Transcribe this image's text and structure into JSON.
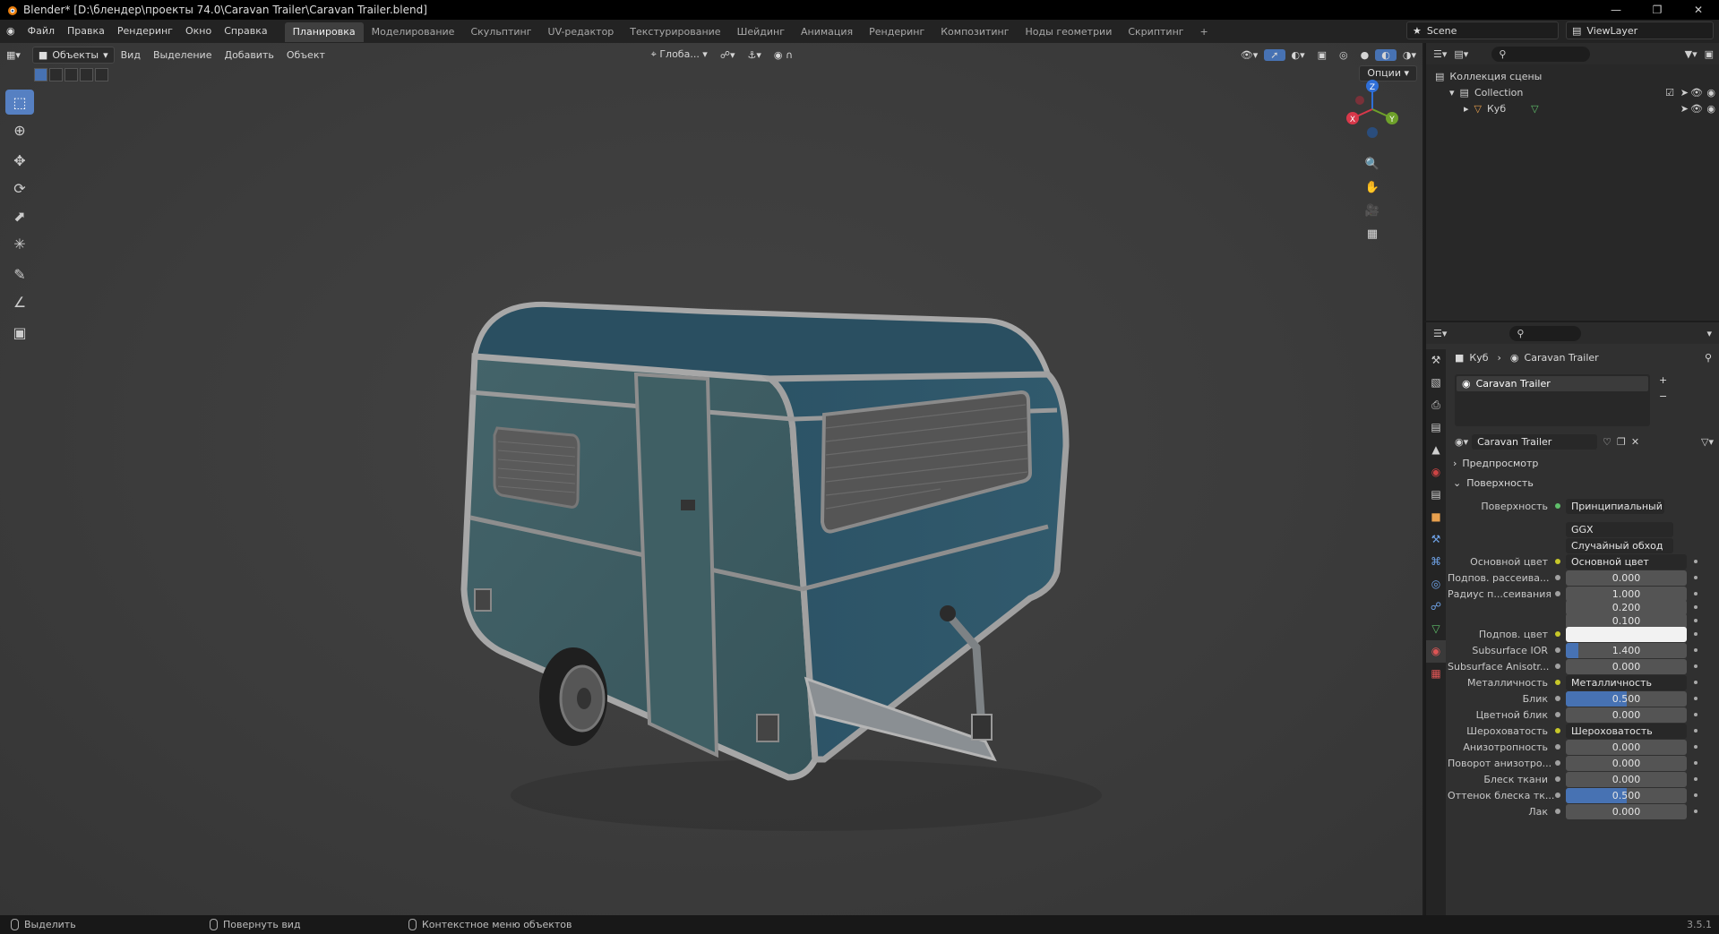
{
  "window": {
    "title": "Blender* [D:\\блендер\\проекты 74.0\\Caravan Trailer\\Caravan Trailer.blend]"
  },
  "menu": [
    "Файл",
    "Правка",
    "Рендеринг",
    "Окно",
    "Справка"
  ],
  "workspaces": [
    "Планировка",
    "Моделирование",
    "Скульптинг",
    "UV-редактор",
    "Текстурирование",
    "Шейдинг",
    "Анимация",
    "Рендеринг",
    "Композитинг",
    "Ноды геометрии",
    "Скриптинг"
  ],
  "scene_name": "Scene",
  "view_layer": "ViewLayer",
  "viewport": {
    "mode": "Объекты",
    "menu": [
      "Вид",
      "Выделение",
      "Добавить",
      "Объект"
    ],
    "orientation": "Глоба...",
    "options_label": "Опции",
    "gizmo": {
      "x": "X",
      "y": "Y",
      "z": "Z"
    }
  },
  "outliner": {
    "rows": [
      "Коллекция сцены",
      "Collection",
      "Куб"
    ]
  },
  "properties": {
    "breadcrumb_object": "Куб",
    "breadcrumb_material": "Caravan Trailer",
    "slot_name": "Caravan Trailer",
    "material_name": "Caravan Trailer",
    "preview_label": "Предпросмотр",
    "surface_panel": "Поверхность",
    "surface_label": "Поверхность",
    "surface_value": "Принципиальный BSDF",
    "distribution": "GGX",
    "subsurface_method": "Случайный обход",
    "rows": [
      {
        "label": "Основной цвет",
        "value": "Основной цвет",
        "kind": "link"
      },
      {
        "label": "Подпов. рассеива...",
        "value": "0.000",
        "kind": "num",
        "fill": 0
      },
      {
        "label": "Радиус п...сеивания",
        "value": "1.000",
        "kind": "num",
        "fill": 0
      },
      {
        "label": "",
        "value": "0.200",
        "kind": "num",
        "fill": 0
      },
      {
        "label": "",
        "value": "0.100",
        "kind": "num",
        "fill": 0
      },
      {
        "label": "Подпов. цвет",
        "value": "",
        "kind": "color"
      },
      {
        "label": "Subsurface IOR",
        "value": "1.400",
        "kind": "num",
        "fill": 0.1
      },
      {
        "label": "Subsurface Anisotr...",
        "value": "0.000",
        "kind": "num",
        "fill": 0
      },
      {
        "label": "Металличность",
        "value": "Металличность",
        "kind": "link"
      },
      {
        "label": "Блик",
        "value": "0.500",
        "kind": "num",
        "fill": 0.5
      },
      {
        "label": "Цветной блик",
        "value": "0.000",
        "kind": "num",
        "fill": 0
      },
      {
        "label": "Шероховатость",
        "value": "Шероховатость",
        "kind": "link"
      },
      {
        "label": "Анизотропность",
        "value": "0.000",
        "kind": "num",
        "fill": 0
      },
      {
        "label": "Поворот анизотро...",
        "value": "0.000",
        "kind": "num",
        "fill": 0
      },
      {
        "label": "Блеск ткани",
        "value": "0.000",
        "kind": "num",
        "fill": 0
      },
      {
        "label": "Оттенок блеска тк...",
        "value": "0.500",
        "kind": "num",
        "fill": 0.5
      },
      {
        "label": "Лак",
        "value": "0.000",
        "kind": "num",
        "fill": 0
      }
    ]
  },
  "status": {
    "select": "Выделить",
    "rotate": "Повернуть вид",
    "context": "Контекстное меню объектов",
    "version": "3.5.1"
  },
  "colors": {
    "accent": "#4772b3",
    "trailer_body": "#3d5a60",
    "trailer_roof": "#2f5566"
  }
}
